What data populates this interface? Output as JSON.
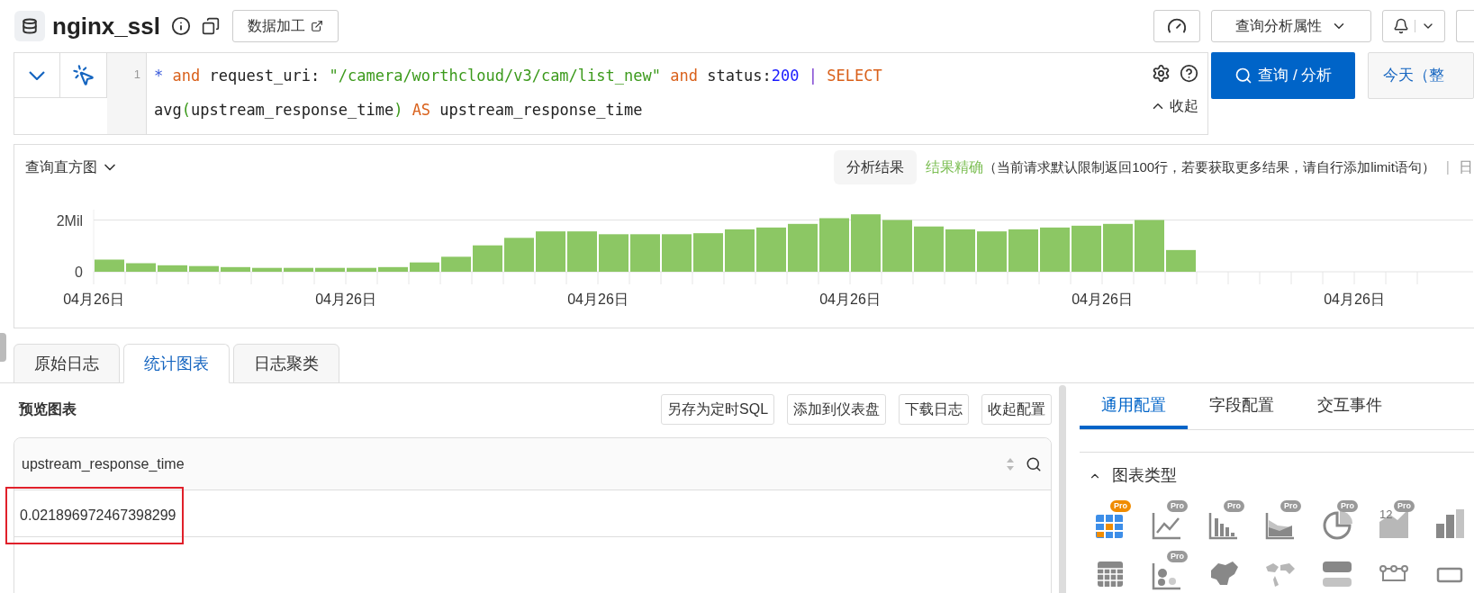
{
  "header": {
    "title": "nginx_ssl",
    "process_button": "数据加工",
    "properties_button": "查询分析属性"
  },
  "query": {
    "line_number": "1",
    "lines": [
      [
        {
          "text": "* ",
          "kind": "operator"
        },
        {
          "text": "and",
          "kind": "keyword"
        },
        {
          "text": " request_uri: ",
          "kind": "plain"
        },
        {
          "text": "\"/camera/worthcloud/v3/cam/list_new\"",
          "kind": "string"
        },
        {
          "text": " and",
          "kind": "keyword"
        },
        {
          "text": " status:",
          "kind": "plain"
        },
        {
          "text": "200",
          "kind": "number"
        },
        {
          "text": " | ",
          "kind": "pipe"
        },
        {
          "text": "SELECT",
          "kind": "keyword"
        }
      ],
      [
        {
          "text": "avg",
          "kind": "plain"
        },
        {
          "text": "(",
          "kind": "paren"
        },
        {
          "text": "upstream_response_time",
          "kind": "plain"
        },
        {
          "text": ")",
          "kind": "paren"
        },
        {
          "text": " AS",
          "kind": "keyword"
        },
        {
          "text": " upstream_response_time",
          "kind": "plain"
        }
      ]
    ],
    "collapse": "收起",
    "search_button": "查询 / 分析",
    "time_button": "今天（整"
  },
  "histogram": {
    "title": "查询直方图",
    "result_button": "分析结果",
    "accuracy": "结果精确",
    "note": "（当前请求默认限制返回100行，若要获取更多结果，请自行添加limit语句）",
    "separator": "|",
    "log_link": "日",
    "chart_data": {
      "type": "bar",
      "ylim": [
        0,
        2.4
      ],
      "yticks": [
        0,
        {
          "value": 2,
          "label": "2Mil"
        }
      ],
      "categories": [
        "04月26日",
        null,
        null,
        null,
        null,
        null,
        null,
        null,
        "04月26日",
        null,
        null,
        null,
        null,
        null,
        null,
        null,
        "04月26日",
        null,
        null,
        null,
        null,
        null,
        null,
        null,
        "04月26日",
        null,
        null,
        null,
        null,
        null,
        null,
        null,
        "04月26日",
        null,
        null,
        null,
        null,
        null,
        null,
        null,
        "04月26日",
        null,
        null
      ],
      "series": [
        {
          "color": "#8cc764",
          "values": [
            0.47,
            0.33,
            0.25,
            0.22,
            0.18,
            0.15,
            0.15,
            0.15,
            0.15,
            0.18,
            0.36,
            0.58,
            1.02,
            1.31,
            1.56,
            1.56,
            1.45,
            1.45,
            1.45,
            1.49,
            1.64,
            1.71,
            1.85,
            2.07,
            2.22,
            2.0,
            1.75,
            1.64,
            1.56,
            1.64,
            1.71,
            1.78,
            1.85,
            2.0,
            0.84,
            null,
            null,
            null,
            null,
            null,
            null,
            null,
            null
          ]
        }
      ]
    }
  },
  "tabs": [
    {
      "label": "原始日志",
      "selected": false
    },
    {
      "label": "统计图表",
      "selected": true
    },
    {
      "label": "日志聚类",
      "selected": false
    }
  ],
  "preview": {
    "title": "预览图表",
    "buttons": [
      "另存为定时SQL",
      "添加到仪表盘",
      "下载日志",
      "收起配置"
    ],
    "table": {
      "columns": [
        "upstream_response_time"
      ],
      "rows": [
        [
          {
            "text": "0.021896972467398299",
            "highlighted": true
          }
        ]
      ]
    }
  },
  "config": {
    "tabs": [
      {
        "label": "通用配置",
        "selected": true
      },
      {
        "label": "字段配置",
        "selected": false
      },
      {
        "label": "交互事件",
        "selected": false
      }
    ],
    "section": {
      "title": "图表类型",
      "expanded": true
    },
    "chart_types": [
      {
        "kind": "table",
        "badge": "Pro",
        "selected": true
      },
      {
        "kind": "line",
        "badge": "Pro",
        "selected": false
      },
      {
        "kind": "bar",
        "badge": "Pro",
        "selected": false
      },
      {
        "kind": "area",
        "badge": "Pro",
        "selected": false
      },
      {
        "kind": "pie",
        "badge": "Pro",
        "selected": false
      },
      {
        "kind": "number",
        "badge": "Pro",
        "figure": "12",
        "selected": false
      },
      {
        "kind": "columns",
        "selected": false
      },
      {
        "kind": "grid",
        "selected": false
      },
      {
        "kind": "scatter",
        "badge": "Pro",
        "selected": false
      },
      {
        "kind": "map",
        "selected": false
      },
      {
        "kind": "worldmap",
        "selected": false
      },
      {
        "kind": "progress",
        "selected": false
      },
      {
        "kind": "flow",
        "selected": false
      },
      {
        "kind": "box",
        "selected": false
      }
    ]
  }
}
